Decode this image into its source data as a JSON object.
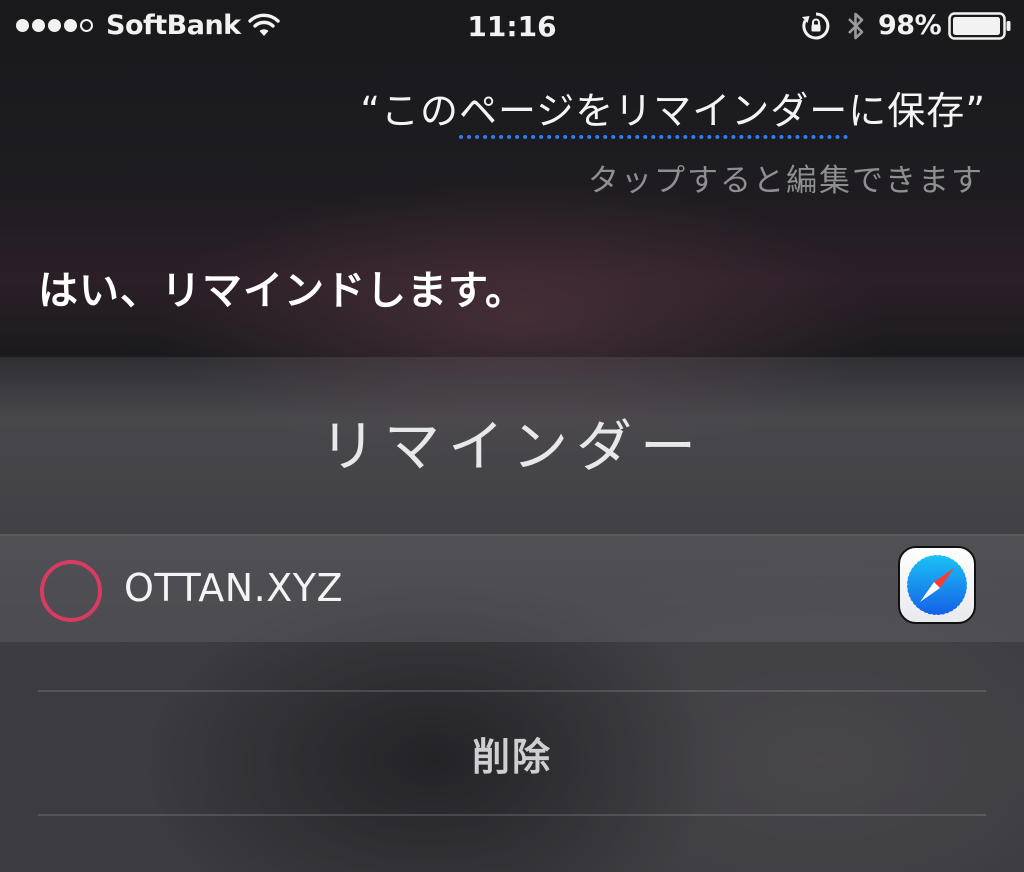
{
  "status_bar": {
    "signal_bars_filled": 4,
    "signal_bars_total": 5,
    "carrier": "SoftBank",
    "time": "11:16",
    "battery_percent": "98%",
    "battery_level": 0.98,
    "icons": [
      "signal-dots",
      "wifi-icon",
      "orientation-lock-icon",
      "bluetooth-icon",
      "battery-icon"
    ]
  },
  "siri": {
    "query_open_quote": "“",
    "query_prefix": "この",
    "query_link": "ページをリマインダー",
    "query_suffix": "に保存",
    "query_close_quote": "”",
    "tap_hint": "タップすると編集できます",
    "response": "はい、リマインドします。"
  },
  "reminder_card": {
    "title": "リマインダー",
    "item": {
      "text": "OTTAN.XYZ",
      "completed": false,
      "app_icon": "safari-icon"
    },
    "delete_label": "削除"
  },
  "colors": {
    "link_underline": "#2f7cf6",
    "checkbox_ring": "#d93b60",
    "hint_text": "#8f8f92"
  }
}
